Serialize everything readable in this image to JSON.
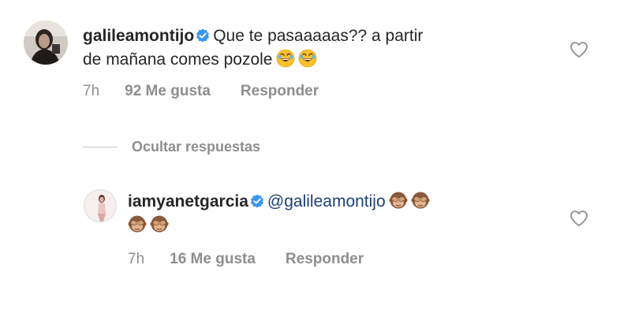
{
  "comment": {
    "username": "galileamontijo",
    "text_line1": "Que te pasaaaaas?? a partir",
    "text_line2": "de mañana comes pozole",
    "time": "7h",
    "likes": "92 Me gusta",
    "reply_label": "Responder"
  },
  "hide_replies_label": "Ocultar respuestas",
  "reply": {
    "username": "iamyanetgarcia",
    "mention": "@galileamontijo",
    "time": "7h",
    "likes": "16 Me gusta",
    "reply_label": "Responder"
  },
  "icons": {
    "verified": "verified-badge-icon",
    "like": "heart-outline-icon",
    "emoji_laugh": "rolling-on-floor-laughing-emoji",
    "emoji_monkey": "see-no-evil-monkey-emoji"
  },
  "colors": {
    "text": "#262626",
    "muted": "#8e8e8e",
    "verified": "#3897f0",
    "mention": "#1d3f7a"
  }
}
